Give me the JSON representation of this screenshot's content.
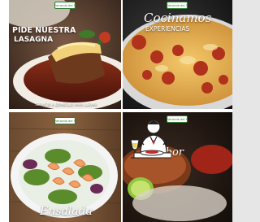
{
  "tiles": [
    {
      "title_line1": "PIDE NUESTRA",
      "title_line2": "LASAGNA",
      "footer": "SERVICIO A DOMICILIO PARA LLEVAR",
      "badge": "Veranda del Parque"
    },
    {
      "script_title": "Cocinamos",
      "subtitle": "EXPERIENCIAS",
      "badge": "Veranda del Parque"
    },
    {
      "script_title": "Ensalada",
      "badge": "Veranda del Parque"
    },
    {
      "script_title": "Sabor",
      "badge": "Veranda del Parque"
    }
  ],
  "colors": {
    "badge_green": "#2f7d32",
    "background": "#ffffff"
  },
  "icons": {
    "overlay": "restaurant-dining-icon"
  }
}
